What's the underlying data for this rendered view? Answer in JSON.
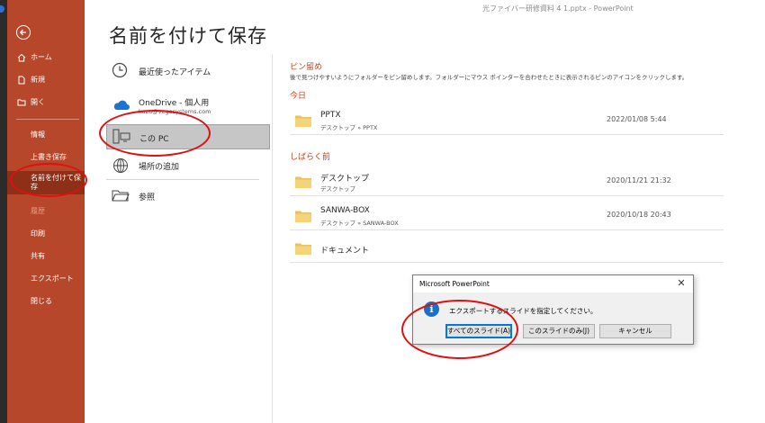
{
  "window": {
    "title": "光ファイバー研修資料 4 1.pptx  -  PowerPoint"
  },
  "sidebar": {
    "back_icon": "back-arrow-icon",
    "items_top": [
      {
        "label": "ホーム",
        "icon": "home-icon"
      },
      {
        "label": "新規",
        "icon": "new-file-icon"
      },
      {
        "label": "開く",
        "icon": "open-folder-icon"
      }
    ],
    "items": [
      {
        "label": "情報"
      },
      {
        "label": "上書き保存"
      },
      {
        "label": "名前を付けて保\n存"
      },
      {
        "label": "履歴"
      },
      {
        "label": "印刷"
      },
      {
        "label": "共有"
      },
      {
        "label": "エクスポート"
      },
      {
        "label": "閉じる"
      }
    ],
    "accent": "#b7472a"
  },
  "page": {
    "title": "名前を付けて保存"
  },
  "locations": [
    {
      "label": "最近使ったアイテム",
      "icon": "clock-icon"
    },
    {
      "label": "OneDrive - 個人用",
      "sublabel": "kazu@vegasystems.com",
      "icon": "onedrive-cloud-icon"
    },
    {
      "label": "この PC",
      "icon": "pc-icon"
    },
    {
      "label": "場所の追加",
      "icon": "add-place-globe-icon"
    },
    {
      "label": "参照",
      "icon": "browse-folder-icon"
    }
  ],
  "pinned": {
    "heading": "ピン留め",
    "description": "後で見つけやすいようにフォルダーをピン留めします。フォルダーにマウス ポインターを合わせたときに表示されるピンのアイコンをクリックします。"
  },
  "today": {
    "heading": "今日",
    "folders": [
      {
        "name": "PPTX",
        "path": "デスクトップ » PPTX",
        "date": "2022/01/08 5:44"
      }
    ]
  },
  "older": {
    "heading": "しばらく前",
    "folders": [
      {
        "name": "デスクトップ",
        "path": "デスクトップ",
        "date": "2020/11/21 21:32"
      },
      {
        "name": "SANWA-BOX",
        "path": "デスクトップ » SANWA-BOX",
        "date": "2020/10/18 20:43"
      },
      {
        "name": "ドキュメント",
        "path": "",
        "date": ""
      }
    ]
  },
  "dialog": {
    "title": "Microsoft PowerPoint",
    "close": "✕",
    "icon_glyph": "i",
    "message": "エクスポートするスライドを指定してください。",
    "buttons": [
      {
        "label": "すべてのスライド(A)"
      },
      {
        "label": "このスライドのみ(J)"
      },
      {
        "label": "キャンセル"
      }
    ]
  }
}
